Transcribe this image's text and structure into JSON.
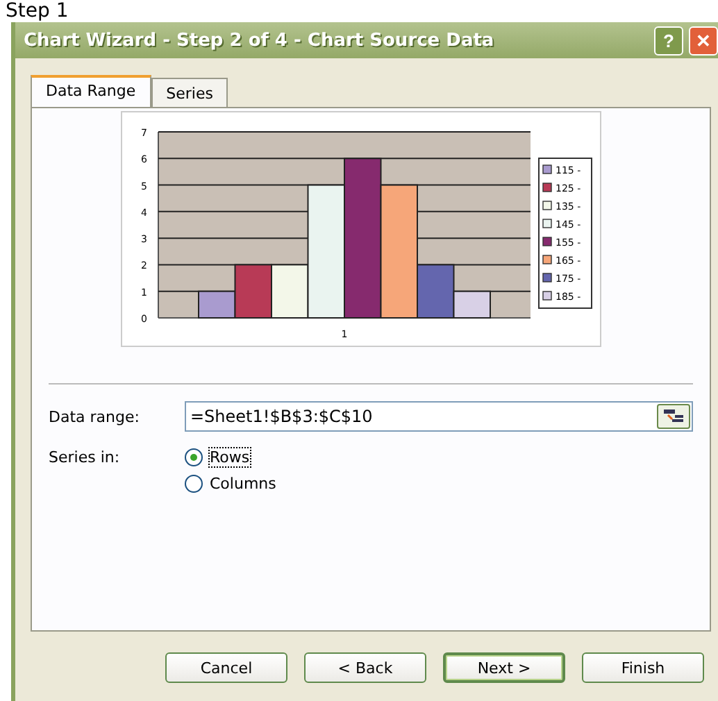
{
  "page_heading": "Step 1",
  "window": {
    "title": "Chart Wizard - Step 2 of 4 - Chart Source Data",
    "controls": [
      "?",
      "✕"
    ]
  },
  "tabs": [
    {
      "label": "Data Range",
      "selected": true
    },
    {
      "label": "Series",
      "selected": false
    }
  ],
  "chart_data": {
    "type": "bar",
    "categories": [
      "1"
    ],
    "ylim": [
      0,
      7
    ],
    "grid": true,
    "legend": true,
    "yticks": [
      0,
      1,
      2,
      3,
      4,
      5,
      6,
      7
    ],
    "series": [
      {
        "name": "115 -",
        "color": "#a99bcf",
        "values": [
          1
        ]
      },
      {
        "name": "125 -",
        "color": "#b83a56",
        "values": [
          2
        ]
      },
      {
        "name": "135 -",
        "color": "#f3f7e9",
        "values": [
          2
        ]
      },
      {
        "name": "145 -",
        "color": "#eaf4f0",
        "values": [
          5
        ]
      },
      {
        "name": "155 -",
        "color": "#862a6e",
        "values": [
          6
        ]
      },
      {
        "name": "165 -",
        "color": "#f6a679",
        "values": [
          5
        ]
      },
      {
        "name": "175 -",
        "color": "#6466ae",
        "values": [
          2
        ]
      },
      {
        "name": "185 -",
        "color": "#d8d0e6",
        "values": [
          1
        ]
      }
    ]
  },
  "data_range": {
    "label": "Data range:",
    "value": "=Sheet1!$B$3:$C$10"
  },
  "series_in": {
    "label": "Series in:",
    "options": [
      {
        "label": "Rows",
        "selected": true
      },
      {
        "label": "Columns",
        "selected": false
      }
    ]
  },
  "buttons": [
    {
      "label": "Cancel",
      "default": false
    },
    {
      "label": "< Back",
      "default": false
    },
    {
      "label": "Next >",
      "default": true
    },
    {
      "label": "Finish",
      "default": false
    }
  ]
}
